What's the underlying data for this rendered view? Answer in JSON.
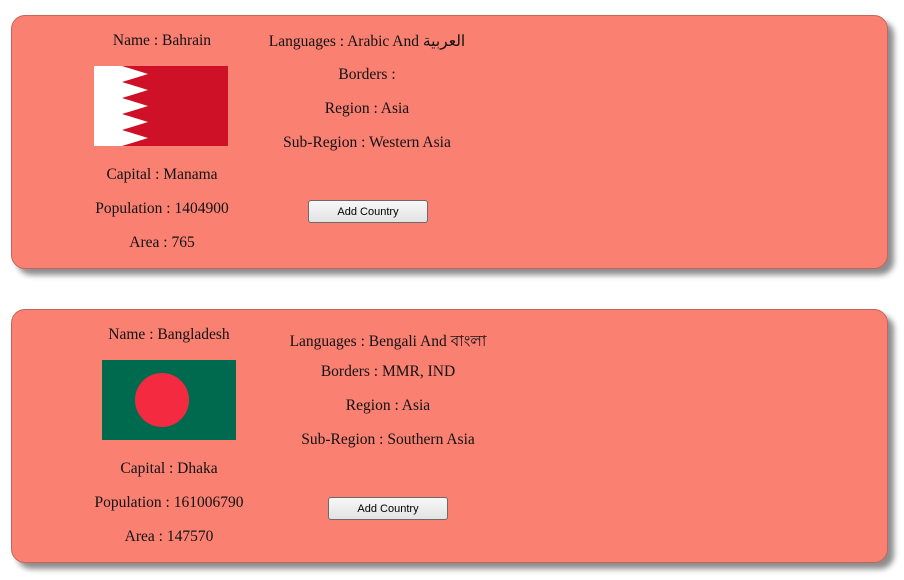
{
  "cards": [
    {
      "name": "Name : Bahrain",
      "languages": "Languages : Arabic And العربية",
      "borders": "Borders :",
      "region": "Region : Asia",
      "subregion": "Sub-Region : Western Asia",
      "capital": "Capital : Manama",
      "population": "Population : 1404900",
      "area": "Area : 765",
      "button_label": "Add Country",
      "flag": {
        "icon": "bahrain-flag-icon",
        "colors": {
          "red": "#ce1126",
          "white": "#ffffff"
        }
      }
    },
    {
      "name": "Name : Bangladesh",
      "languages": "Languages : Bengali And বাংলা",
      "borders": "Borders : MMR, IND",
      "region": "Region : Asia",
      "subregion": "Sub-Region : Southern Asia",
      "capital": "Capital : Dhaka",
      "population": "Population : 161006790",
      "area": "Area : 147570",
      "button_label": "Add Country",
      "flag": {
        "icon": "bangladesh-flag-icon",
        "colors": {
          "green": "#006a4e",
          "red": "#f42a41"
        }
      }
    }
  ],
  "colors": {
    "card_background": "#fa8072"
  }
}
